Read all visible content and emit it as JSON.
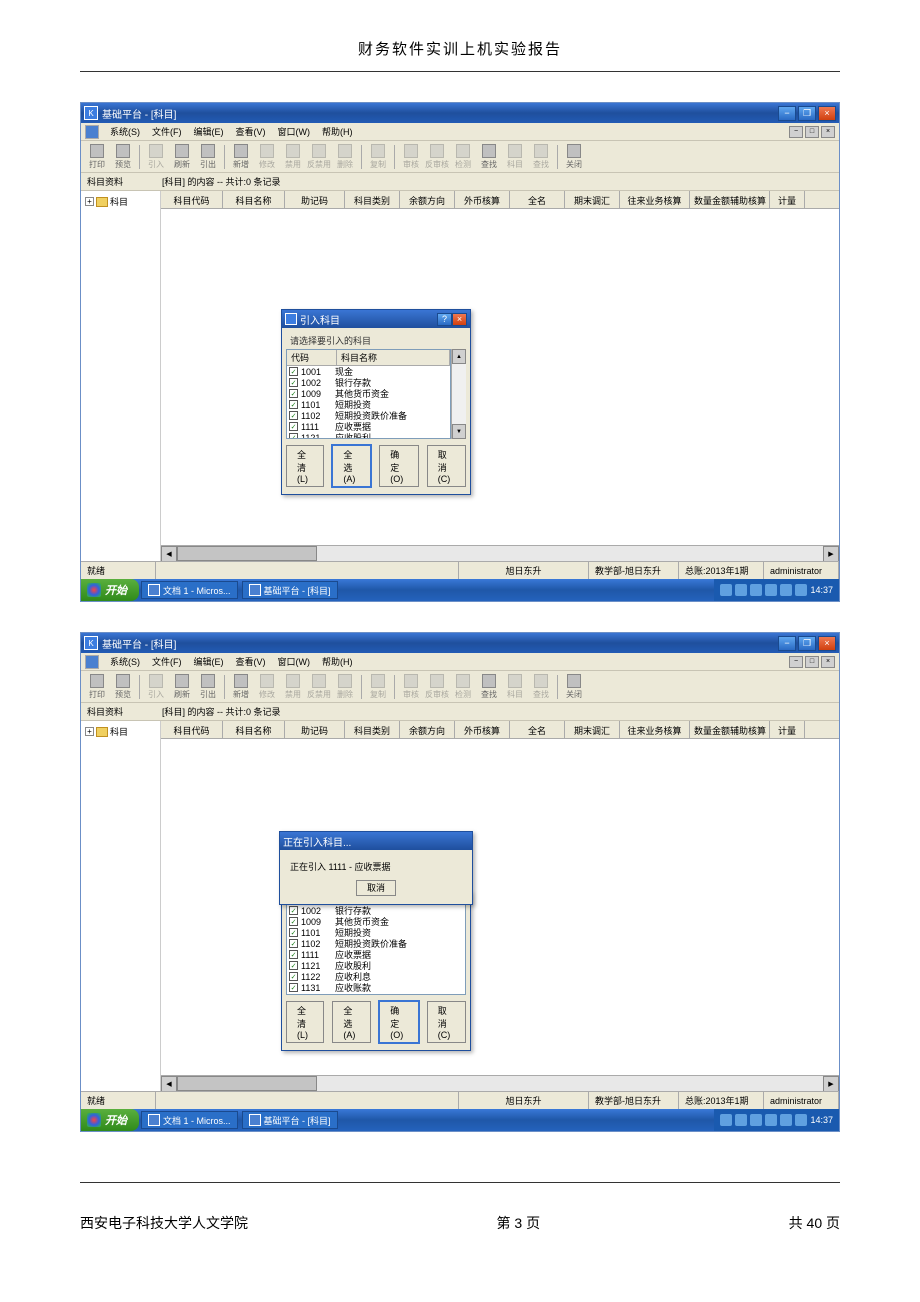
{
  "doc": {
    "header": "财务软件实训上机实验报告",
    "footer_left": "西安电子科技大学人文学院",
    "footer_center": "第 3 页",
    "footer_right": "共 40 页"
  },
  "app": {
    "title": "基础平台 - [科目]",
    "menus": [
      "系统(S)",
      "文件(F)",
      "编辑(E)",
      "查看(V)",
      "窗口(W)",
      "帮助(H)"
    ],
    "toolbar": [
      "打印",
      "预览",
      "",
      "引入",
      "刷新",
      "引出",
      "",
      "新增",
      "修改",
      "禁用",
      "反禁用",
      "删除",
      "",
      "复制",
      "",
      "审核",
      "反审核",
      "检测",
      "查找",
      "科目",
      "查找",
      "",
      "关闭"
    ],
    "tree_label": "科目资料",
    "tree_root": "科目",
    "record_info": "[科目] 的内容 -- 共计:0 条记录",
    "columns": [
      "科目代码",
      "科目名称",
      "助记码",
      "科目类别",
      "余额方向",
      "外币核算",
      "全名",
      "期末调汇",
      "往来业务核算",
      "数量金额辅助核算",
      "计量"
    ],
    "status": {
      "ready": "就绪",
      "company": "旭日东升",
      "dept": "教学部-旭日东升",
      "period": "总账:2013年1期",
      "user": "administrator"
    },
    "taskbar": {
      "start": "开始",
      "tasks": [
        "文档 1 - Micros...",
        "基础平台 - [科目]"
      ],
      "time": "14:37"
    }
  },
  "dialog1": {
    "title": "引入科目",
    "hint": "请选择要引入的科目",
    "headers": [
      "代码",
      "科目名称"
    ],
    "items": [
      {
        "code": "1001",
        "name": "现金"
      },
      {
        "code": "1002",
        "name": "银行存款"
      },
      {
        "code": "1009",
        "name": "其他货币资金"
      },
      {
        "code": "1101",
        "name": "短期投资"
      },
      {
        "code": "1102",
        "name": "短期投资跌价准备"
      },
      {
        "code": "1111",
        "name": "应收票据"
      },
      {
        "code": "1121",
        "name": "应收股利"
      },
      {
        "code": "1122",
        "name": "应收利息"
      },
      {
        "code": "1131",
        "name": "应收账款"
      }
    ],
    "buttons": [
      "全清(L)",
      "全选(A)",
      "确定(O)",
      "取消(C)"
    ]
  },
  "dialog2": {
    "title": "正在引入科目...",
    "text": "正在引入 1111 - 应收票据",
    "cancel": "取消"
  }
}
